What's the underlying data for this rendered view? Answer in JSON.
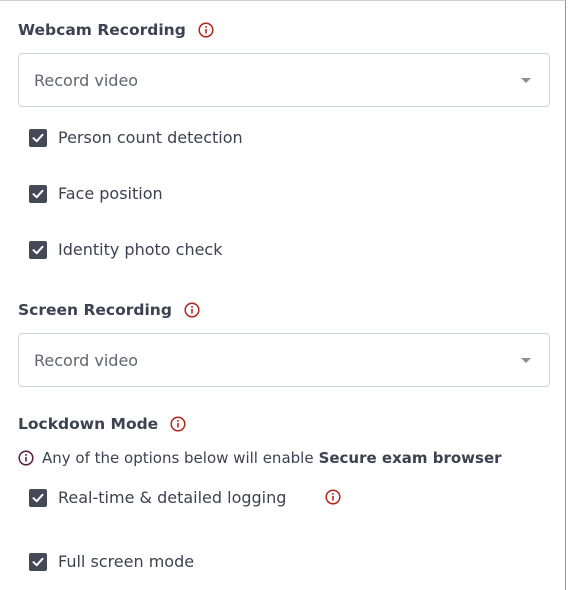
{
  "webcam": {
    "title": "Webcam Recording",
    "select_value": "Record video",
    "options": [
      {
        "label": "Person count detection",
        "checked": true
      },
      {
        "label": "Face position",
        "checked": true
      },
      {
        "label": "Identity photo check",
        "checked": true
      }
    ]
  },
  "screen": {
    "title": "Screen Recording",
    "select_value": "Record video"
  },
  "lockdown": {
    "title": "Lockdown Mode",
    "note_text": "Any of the options below will enable",
    "note_bold": "Secure exam browser",
    "options": [
      {
        "label": "Real-time & detailed logging",
        "checked": true
      },
      {
        "label": "Full screen mode",
        "checked": true
      }
    ]
  },
  "colors": {
    "info_icon": "#b3261e",
    "note_icon": "#5a1e3a",
    "checkbox": "#434a55",
    "text": "#3b4250"
  },
  "icons": {
    "info": "info-circle-icon",
    "check": "checkmark-icon",
    "caret": "caret-down-icon"
  }
}
